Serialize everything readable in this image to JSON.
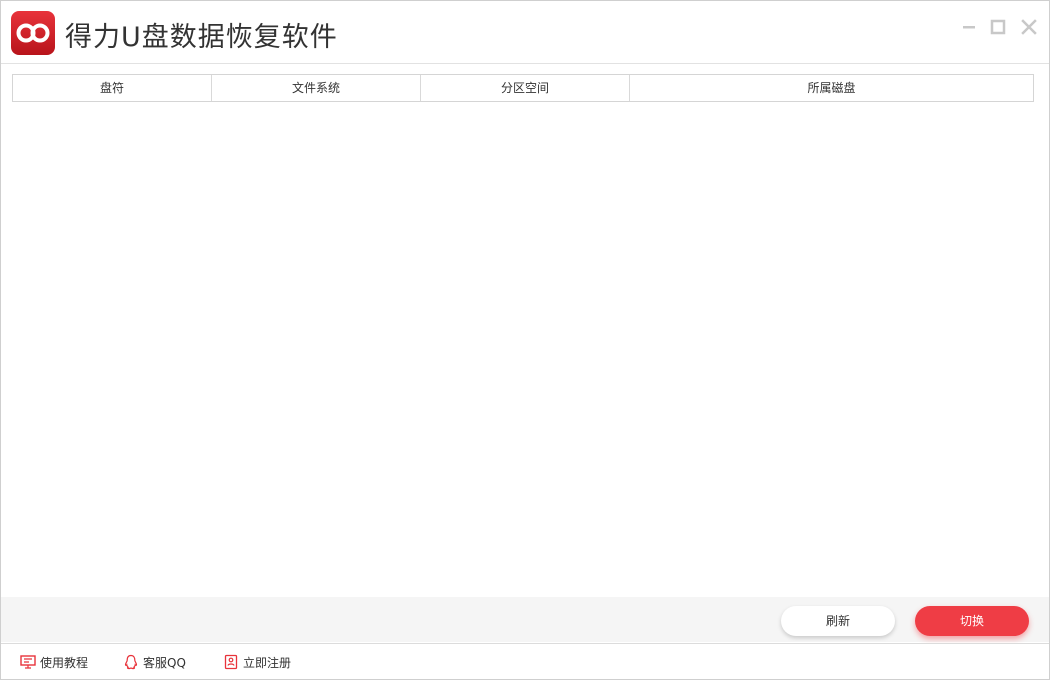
{
  "app": {
    "title": "得力U盘数据恢复软件",
    "logo_icon": "infinity-logo-icon",
    "accent_color": "#ef3d45"
  },
  "window_controls": {
    "minimize_icon": "minimize-icon",
    "maximize_icon": "maximize-icon",
    "close_icon": "close-icon"
  },
  "table": {
    "columns": [
      "盘符",
      "文件系统",
      "分区空间",
      "所属磁盘"
    ],
    "rows": []
  },
  "actions": {
    "refresh_label": "刷新",
    "switch_label": "切换"
  },
  "footer": {
    "tutorial_label": "使用教程",
    "tutorial_icon": "monitor-icon",
    "qq_label": "客服QQ",
    "qq_icon": "qq-penguin-icon",
    "register_label": "立即注册",
    "register_icon": "register-doc-icon"
  }
}
